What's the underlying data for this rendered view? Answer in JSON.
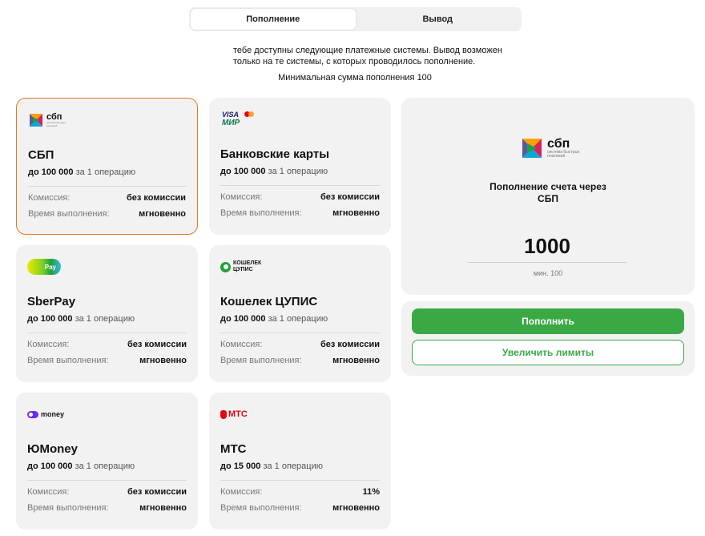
{
  "tabs": [
    {
      "label": "Пополнение",
      "active": true
    },
    {
      "label": "Вывод",
      "active": false
    }
  ],
  "info": {
    "line1": "тебе доступны следующие платежные системы. Вывод возможен",
    "line2": "только на те системы, с которых проводилось пополнение.",
    "min_sum": "Минимальная сумма пополнения 100"
  },
  "labels": {
    "commission": "Комиссия:",
    "time": "Время выполнения:",
    "per_operation": "за 1 операцию"
  },
  "methods": [
    {
      "name": "СБП",
      "limit": "до 100 000",
      "commission": "без комиссии",
      "time": "мгновенно",
      "icon": "sbp-logo-icon",
      "selected": true
    },
    {
      "name": "Банковские карты",
      "limit": "до 100 000",
      "commission": "без комиссии",
      "time": "мгновенно",
      "icon": "visa-mir-logo-icon",
      "selected": false
    },
    {
      "name": "SberPay",
      "limit": "до 100 000",
      "commission": "без комиссии",
      "time": "мгновенно",
      "icon": "sberpay-logo-icon",
      "selected": false
    },
    {
      "name": "Кошелек ЦУПИС",
      "limit": "до 100 000",
      "commission": "без комиссии",
      "time": "мгновенно",
      "icon": "cupis-logo-icon",
      "selected": false
    },
    {
      "name": "ЮMoney",
      "limit": "до 100 000",
      "commission": "без комиссии",
      "time": "мгновенно",
      "icon": "yoomoney-logo-icon",
      "selected": false
    },
    {
      "name": "МТС",
      "limit": "до 15 000",
      "commission": "11%",
      "time": "мгновенно",
      "icon": "mts-logo-icon",
      "selected": false
    }
  ],
  "logos": {
    "sbp": "сбп",
    "sbp_sub1": "система быстрых",
    "sbp_sub2": "платежей",
    "visa": "VISA",
    "mir": "МИР",
    "sberpay": "Pay",
    "cupis1": "КОШЕЛЕК",
    "cupis2": "ЦУПИС",
    "yoomoney": "money",
    "mts": "МТС"
  },
  "panel": {
    "title_line1": "Пополнение счета через",
    "title_line2": "СБП",
    "amount": "1000",
    "min_hint": "мин. 100"
  },
  "actions": {
    "deposit": "Пополнить",
    "increase_limits": "Увеличить лимиты"
  },
  "colors": {
    "accent_green": "#3aa945",
    "selected_border": "#e37a1f",
    "card_bg": "#f2f2f2",
    "mts_red": "#e30611",
    "yoomoney_purple": "#6a2ee8"
  }
}
